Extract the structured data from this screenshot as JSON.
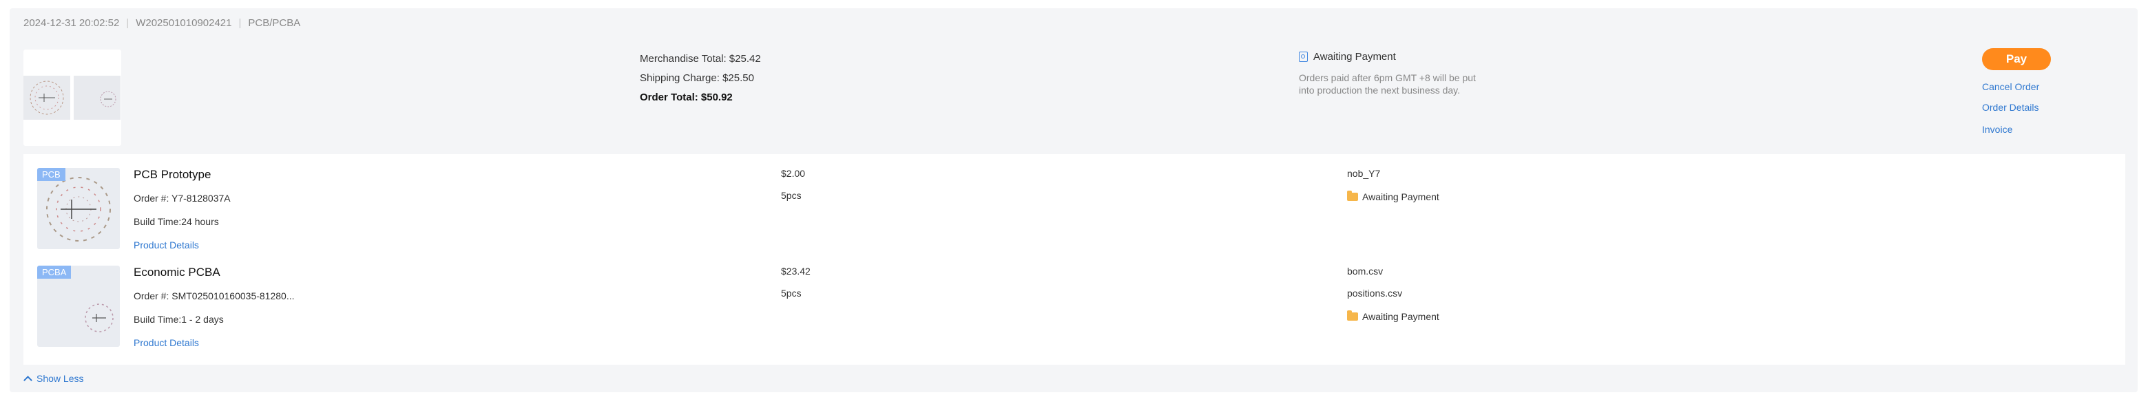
{
  "order": {
    "date": "2024-12-31 20:02:52",
    "order_no": "W202501010902421",
    "category": "PCB/PCBA"
  },
  "summary": {
    "merchandise_total": "Merchandise Total: $25.42",
    "shipping_charge": "Shipping Charge: $25.50",
    "order_total": "Order Total: $50.92"
  },
  "status": {
    "label": "Awaiting Payment",
    "note": "Orders paid after 6pm GMT +8 will be put into production the next business day."
  },
  "actions": {
    "pay": "Pay",
    "cancel": "Cancel Order",
    "details": "Order Details",
    "invoice": "Invoice"
  },
  "items": [
    {
      "badge": "PCB",
      "name": "PCB Prototype",
      "order": "Order #: Y7-8128037A",
      "build": "Build Time:24 hours",
      "link": "Product Details",
      "price": "$2.00",
      "qty": "5pcs",
      "file": "nob_Y7",
      "status": "Awaiting Payment"
    },
    {
      "badge": "PCBA",
      "name": "Economic PCBA",
      "order": "Order #: SMT025010160035-81280...",
      "build": "Build Time:1 - 2 days",
      "link": "Product Details",
      "price": "$23.42",
      "qty": "5pcs",
      "file1": "bom.csv",
      "file2": "positions.csv",
      "status": "Awaiting Payment"
    }
  ],
  "show_less": "Show Less",
  "colors": {
    "accent": "#2f78d0",
    "pay": "#ff8a1c",
    "badge": "#8cb8f5",
    "card_bg": "#f4f5f7"
  },
  "icons": {
    "status": "payment-document-icon",
    "item_status": "folder-icon",
    "show_less": "chevron-up-icon"
  }
}
